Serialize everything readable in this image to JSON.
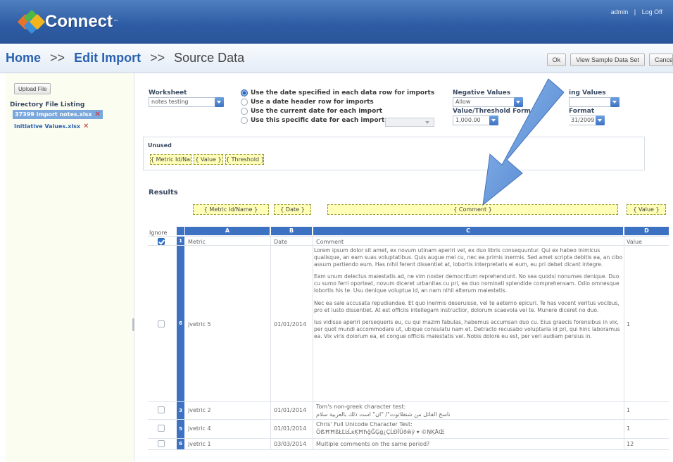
{
  "header": {
    "app_name": "Connect",
    "tm": "™",
    "user": "admin",
    "separator": "|",
    "logout": "Log Off"
  },
  "titlebar": {
    "home": "Home",
    "sep": ">>",
    "edit_import": "Edit Import",
    "current": "Source Data",
    "ok_label": "Ok",
    "view_sample_label": "View Sample Data Set",
    "cancel_label": "Cancel"
  },
  "sidebar": {
    "upload_label": "Upload File",
    "directory_label": "Directory File Listing",
    "files": [
      {
        "name": "37399 import notes.xlsx",
        "selected": true
      },
      {
        "name": "Initiative Values.xlsx",
        "selected": false
      }
    ],
    "delete_icon": "✕"
  },
  "worksheet": {
    "label": "Worksheet",
    "value": "notes testing"
  },
  "date_options": [
    {
      "label": "Use the date specified in each data row for imports",
      "selected": true
    },
    {
      "label": "Use a date header row for imports",
      "selected": false
    },
    {
      "label": "Use the current date for each import",
      "selected": false
    },
    {
      "label": "Use this specific date for each import:",
      "selected": false
    }
  ],
  "negative_values": {
    "label": "Negative Values",
    "value": "Allow"
  },
  "missing_values": {
    "label": "ing Values"
  },
  "value_format": {
    "label": "Value/Threshold Form",
    "value": "1,000.00"
  },
  "date_format": {
    "label": "Format",
    "value": "31/2009"
  },
  "unused": {
    "title": "Unused",
    "tags": [
      "{ Metric Id/Name }",
      "{ Value }",
      "{ Threshold }"
    ]
  },
  "results": {
    "title": "Results",
    "col_tags": [
      "{ Metric Id/Name }",
      "{ Date }",
      "{ Comment }",
      "{ Value }"
    ],
    "ignore_label": "Ignore",
    "col_letters": [
      "A",
      "B",
      "C",
      "D"
    ],
    "header_row": {
      "num": "1",
      "metric": "Metric",
      "date": "Date",
      "comment": "Comment",
      "value": "Value"
    },
    "rows": [
      {
        "num": "6",
        "metric": "jvetric 5",
        "date": "01/01/2014",
        "value": "1",
        "comment_paragraphs": [
          "Lorem ipsum dolor sit amet, ex novum utinam aperiri vel, ex duo libris consequuntur. Qui ex habeo inimicus qualisque, an eam suas voluptatibus. Quis augue mei cu, nec ea primis inermis. Sed amet scripta debitis ea, an cibo assum partiendo eum. Has nihil ferent dissentiet at, lobortis interpretaris ei eum, eu pri debet dicant integre.",
          "Eam unum delectus maiestatis ad, ne vim noster democritum reprehendunt. No sea quodsi nonumes denique. Duo cu sumo ferri oporteat, novum diceret urbanitas cu pri, ea duo nominati splendide comprehensam. Odio omnesque lobortis his te. Usu denique voluptua id, an nam nihil alterum maiestatis.",
          "Nec ea sale accusata repudiandae. Et quo inermis deseruisse, vel te aeterno epicuri. Te has vocent veritus vocibus, pro et iusto dissentiet. At est officiis intellegam instructior, dolorum scaevola vel te. Munere diceret no duo.",
          "Ius vidisse aperiri persequeris eu, cu qui mazim fabulas, habemus accumsan duo cu. Eius graecis forensibus in vix, per quot mundi accommodare ut, ubique consulatu nam et. Detracto recusabo voluptaria id pri, qui hinc laboramus ea. Vix viris dolorum ea, et congue officiis maiestatis vel. Nobis dolore eu est, per veri audiam persius in."
        ]
      },
      {
        "num": "3",
        "metric": "jvetric 2",
        "date": "01/01/2014",
        "value": "1",
        "comment_lines": [
          "Tom's non-greek character test:",
          "ناسخ القاتل من شنقلاتوت\"/ \"ان\" است ذلك بالعربية سلام"
        ]
      },
      {
        "num": "5",
        "metric": "jvetric 4",
        "date": "01/01/2014",
        "value": "1",
        "comment_lines": [
          "Chris' Full Unicode Character Test:",
          "ÖẞĦĦßŁĽĿĹĸĶĦħĝĞĢġ¿ÇĹĐÏÜðŵŷ ▾ ©ŅĶĀŒ"
        ]
      },
      {
        "num": "6",
        "metric": "jvetric 1",
        "date": "03/03/2014",
        "value": "12",
        "comment_lines": [
          "Multiple comments on the same period?"
        ]
      }
    ]
  },
  "colors": {
    "header_blue": "#2d5ba3",
    "link_blue": "#2a62b0",
    "column_header": "#3d72c2",
    "sidebar_bg": "#fcfdf1",
    "tag_yellow": "#ffffb8",
    "arrow": "#4a86d4"
  }
}
